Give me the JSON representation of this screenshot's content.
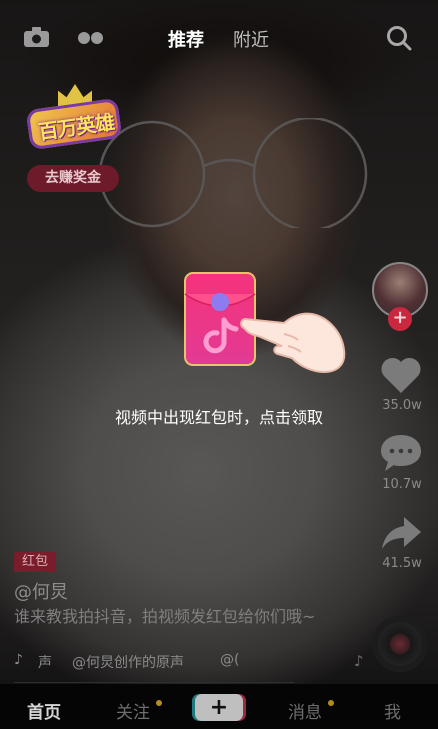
{
  "top_bar": {
    "tabs": [
      "推荐",
      "附近"
    ],
    "active_tab": "推荐",
    "icons": [
      "camera-icon",
      "live-dots-icon",
      "search-icon"
    ]
  },
  "campaign": {
    "logo_text": "百万英雄",
    "earn_button": "去赚奖金"
  },
  "right_rail": {
    "like_count": "35.0w",
    "comment_count": "10.7w",
    "share_count": "41.5w",
    "icons": [
      "avatar",
      "follow-plus-icon",
      "heart-icon",
      "comment-icon",
      "share-icon",
      "music-disc-icon"
    ]
  },
  "guide": {
    "tip_text": "视频中出现红包时，点击领取",
    "icons": [
      "red-packet-icon",
      "pointing-hand-icon"
    ]
  },
  "video_info": {
    "tag": "红包",
    "author": "@何炅",
    "description": "谁来教我拍抖音，拍视频发红包给你们哦~",
    "music_note": "♪",
    "music_label": "声",
    "music_title": "@何炅创作的原声",
    "music_title_cont": "@("
  },
  "bottom_nav": {
    "home": "首页",
    "follow": "关注",
    "plus": "+",
    "messages": "消息",
    "me": "我"
  },
  "colors": {
    "accent_red": "#c9283f",
    "tag_red": "#7a1c2a",
    "nav_dot": "#b58d1d"
  }
}
